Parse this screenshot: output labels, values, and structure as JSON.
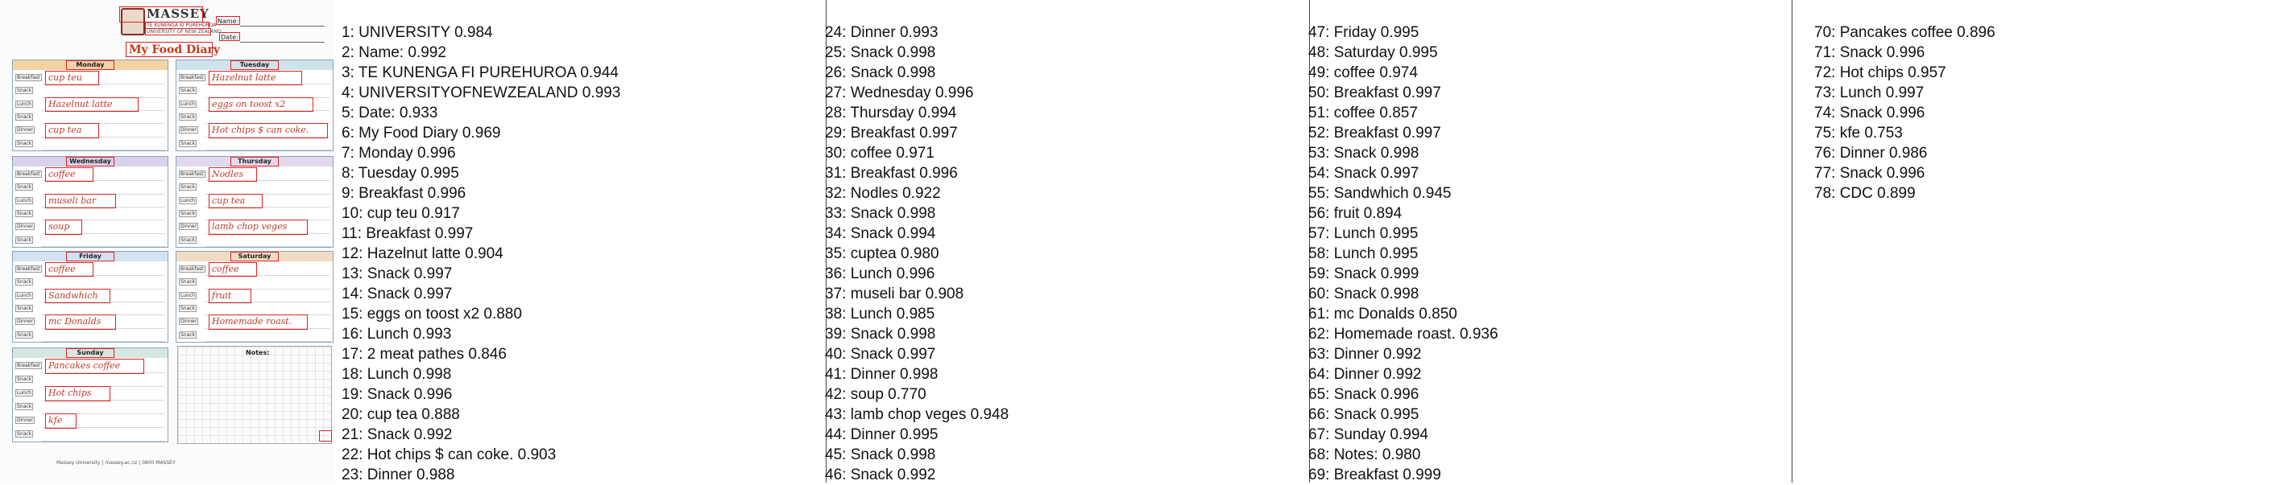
{
  "document": {
    "university": "MASSEY",
    "university_sub1": "TE KUNENGA KI PUREHUROA",
    "university_sub2": "UNIVERSITY OF NEW ZEALAND",
    "name_label": "Name:",
    "date_label": "Date:",
    "title": "My Food Diary",
    "notes_label": "Notes:",
    "footer": "Massey University | massey.ac.nz | 0800 MASSEY",
    "days": [
      {
        "name": "Monday",
        "color": "#f3d3a4",
        "meals": [
          "Breakfast",
          "Snack",
          "Lunch",
          "Snack",
          "Dinner",
          "Snack"
        ],
        "entries": [
          "cup teu",
          "Hazelnut latte",
          "cup tea"
        ]
      },
      {
        "name": "Tuesday",
        "color": "#cfe3ea",
        "meals": [
          "Breakfast",
          "Snack",
          "Lunch",
          "Snack",
          "Dinner",
          "Snack"
        ],
        "entries": [
          "Hazelnut latte",
          "eggs on toost x2",
          "Hot chips $ can coke."
        ]
      },
      {
        "name": "Wednesday",
        "color": "#d9d2ea",
        "meals": [
          "Breakfast",
          "Snack",
          "Lunch",
          "Snack",
          "Dinner",
          "Snack"
        ],
        "entries": [
          "coffee",
          "museli bar",
          "soup"
        ]
      },
      {
        "name": "Thursday",
        "color": "#e2d9ec",
        "meals": [
          "Breakfast",
          "Snack",
          "Lunch",
          "Snack",
          "Dinner",
          "Snack"
        ],
        "entries": [
          "Nodles",
          "cup tea",
          "lamb chop veges"
        ]
      },
      {
        "name": "Friday",
        "color": "#d3e2f2",
        "meals": [
          "Breakfast",
          "Snack",
          "Lunch",
          "Snack",
          "Dinner",
          "Snack"
        ],
        "entries": [
          "coffee",
          "Sandwhich",
          "mc Donalds"
        ]
      },
      {
        "name": "Saturday",
        "color": "#f0dcc4",
        "meals": [
          "Breakfast",
          "Snack",
          "Lunch",
          "Snack",
          "Dinner",
          "Snack"
        ],
        "entries": [
          "coffee",
          "fruit",
          "Homemade roast."
        ]
      },
      {
        "name": "Sunday",
        "color": "#d6e7e2",
        "meals": [
          "Breakfast",
          "Snack",
          "Lunch",
          "Snack",
          "Dinner",
          "Snack"
        ],
        "entries": [
          "Pancakes coffee",
          "Hot chips",
          "kfe"
        ]
      }
    ]
  },
  "ocr_results": [
    "1: UNIVERSITY   0.984",
    "2: Name:   0.992",
    "3: TE KUNENGA FI PUREHUROA   0.944",
    "4: UNIVERSITYOFNEWZEALAND   0.993",
    "5: Date:   0.933",
    "6: My Food Diary   0.969",
    "7: Monday   0.996",
    "8: Tuesday   0.995",
    "9: Breakfast   0.996",
    "10: cup teu   0.917",
    "11: Breakfast   0.997",
    "12: Hazelnut latte   0.904",
    "13: Snack   0.997",
    "14: Snack   0.997",
    "15: eggs on toost x2   0.880",
    "16: Lunch   0.993",
    "17: 2 meat pathes   0.846",
    "18: Lunch   0.998",
    "19: Snack   0.996",
    "20: cup tea   0.888",
    "21: Snack   0.992",
    "22: Hot chips $ can coke.   0.903",
    "23: Dinner   0.988",
    "24: Dinner   0.993",
    "25: Snack   0.998",
    "26: Snack   0.998",
    "27: Wednesday   0.996",
    "28: Thursday   0.994",
    "29: Breakfast   0.997",
    "30: coffee   0.971",
    "31: Breakfast   0.996",
    "32: Nodles   0.922",
    "33: Snack   0.998",
    "34: Snack   0.994",
    "35: cuptea   0.980",
    "36: Lunch   0.996",
    "37: museli bar   0.908",
    "38: Lunch   0.985",
    "39: Snack   0.998",
    "40: Snack   0.997",
    "41: Dinner   0.998",
    "42: soup   0.770",
    "43: lamb chop veges   0.948",
    "44: Dinner   0.995",
    "45: Snack   0.998",
    "46: Snack   0.992",
    "47: Friday   0.995",
    "48: Saturday   0.995",
    "49: coffee   0.974",
    "50: Breakfast   0.997",
    "51: coffee   0.857",
    "52: Breakfast   0.997",
    "53: Snack   0.998",
    "54: Snack   0.997",
    "55: Sandwhich   0.945",
    "56: fruit   0.894",
    "57: Lunch   0.995",
    "58: Lunch   0.995",
    "59: Snack   0.999",
    "60: Snack   0.998",
    "61: mc Donalds   0.850",
    "62: Homemade roast.   0.936",
    "63: Dinner   0.992",
    "64: Dinner   0.992",
    "65: Snack   0.996",
    "66: Snack   0.995",
    "67: Sunday   0.994",
    "68: Notes:   0.980",
    "69: Breakfast   0.999",
    "70: Pancakes coffee   0.896",
    "71: Snack   0.996",
    "72: Hot chips   0.957",
    "73: Lunch   0.997",
    "74: Snack   0.996",
    "75: kfe   0.753",
    "76: Dinner   0.986",
    "77: Snack   0.996",
    "78: CDC   0.899"
  ]
}
